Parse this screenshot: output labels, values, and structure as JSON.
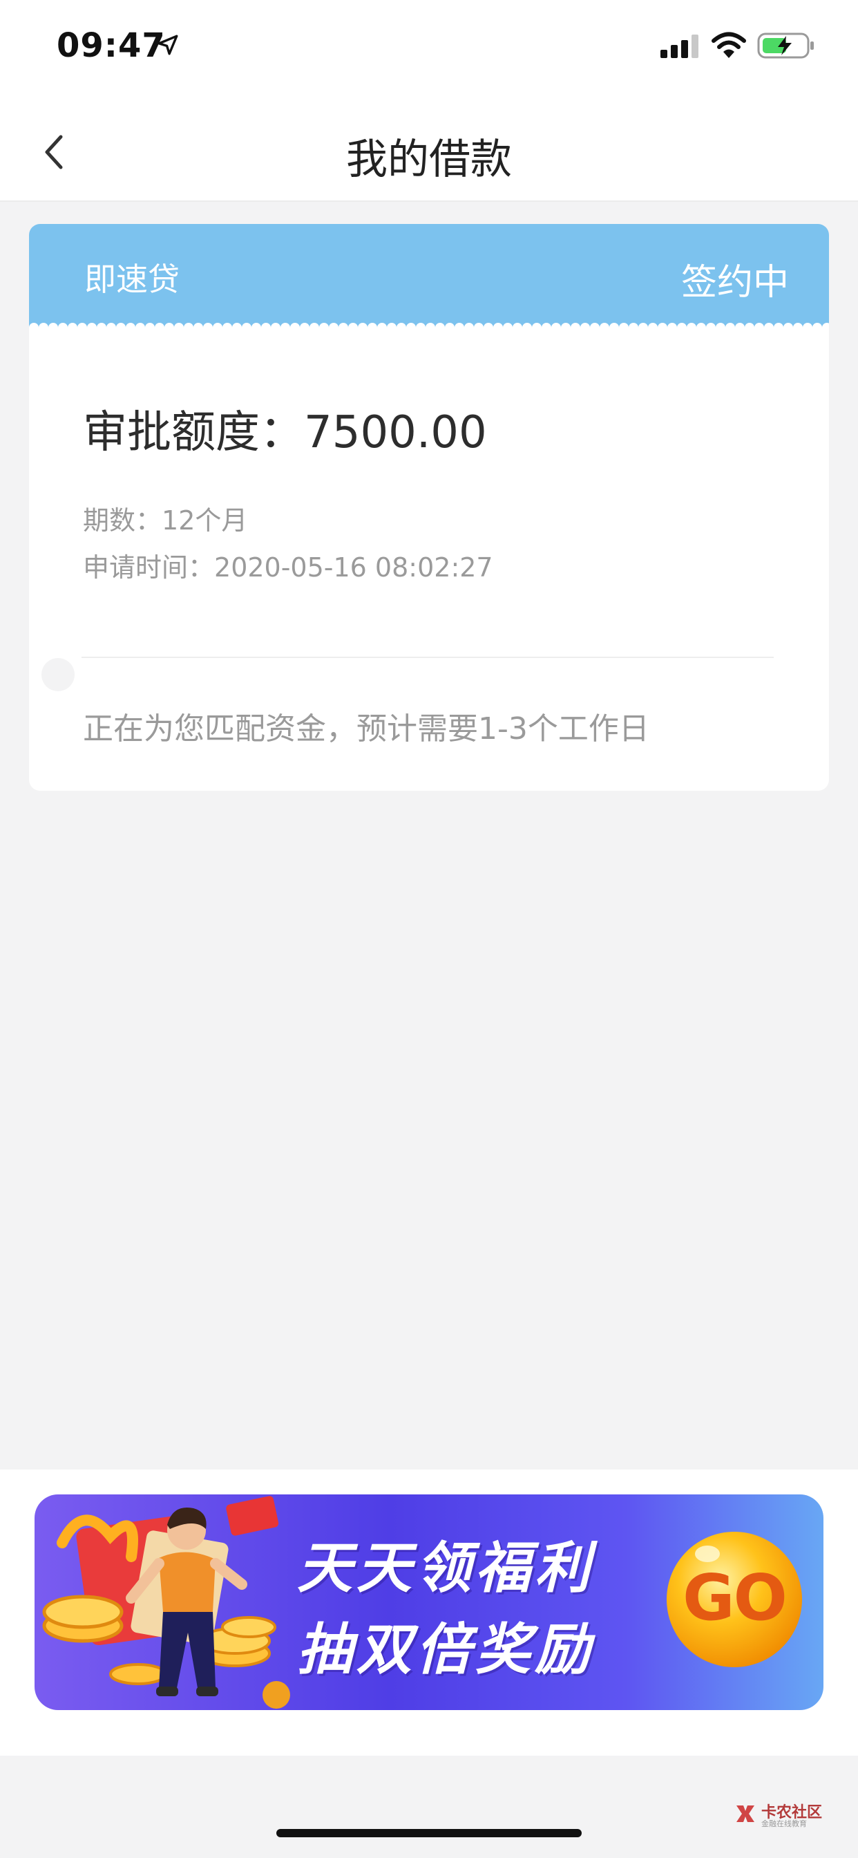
{
  "status_bar": {
    "time": "09:47",
    "icons": [
      "location-arrow-icon",
      "cellular-signal-icon",
      "wifi-icon",
      "battery-charging-icon"
    ]
  },
  "nav": {
    "back_icon": "chevron-left-icon",
    "title": "我的借款"
  },
  "loan_card": {
    "product_name": "即速贷",
    "status": "签约中",
    "approved_amount_label": "审批额度：",
    "approved_amount_value": "7500.00",
    "term_label": "期数：",
    "term_value": "12个月",
    "apply_time_label": "申请时间：",
    "apply_time_value": "2020-05-16 08:02:27",
    "matching_note": "正在为您匹配资金，预计需要1-3个工作日",
    "colors": {
      "header": "#7cc2ee"
    }
  },
  "promo_banner": {
    "line1": "天天领福利",
    "line2": "抽双倍奖励",
    "go_label": "GO",
    "colors": {
      "gradient_start": "#7a5cf0",
      "gradient_end": "#68a7f4",
      "go_button": "#f6b81e"
    }
  },
  "watermark": {
    "title": "卡农社区",
    "subtitle": "金融在线教育"
  }
}
